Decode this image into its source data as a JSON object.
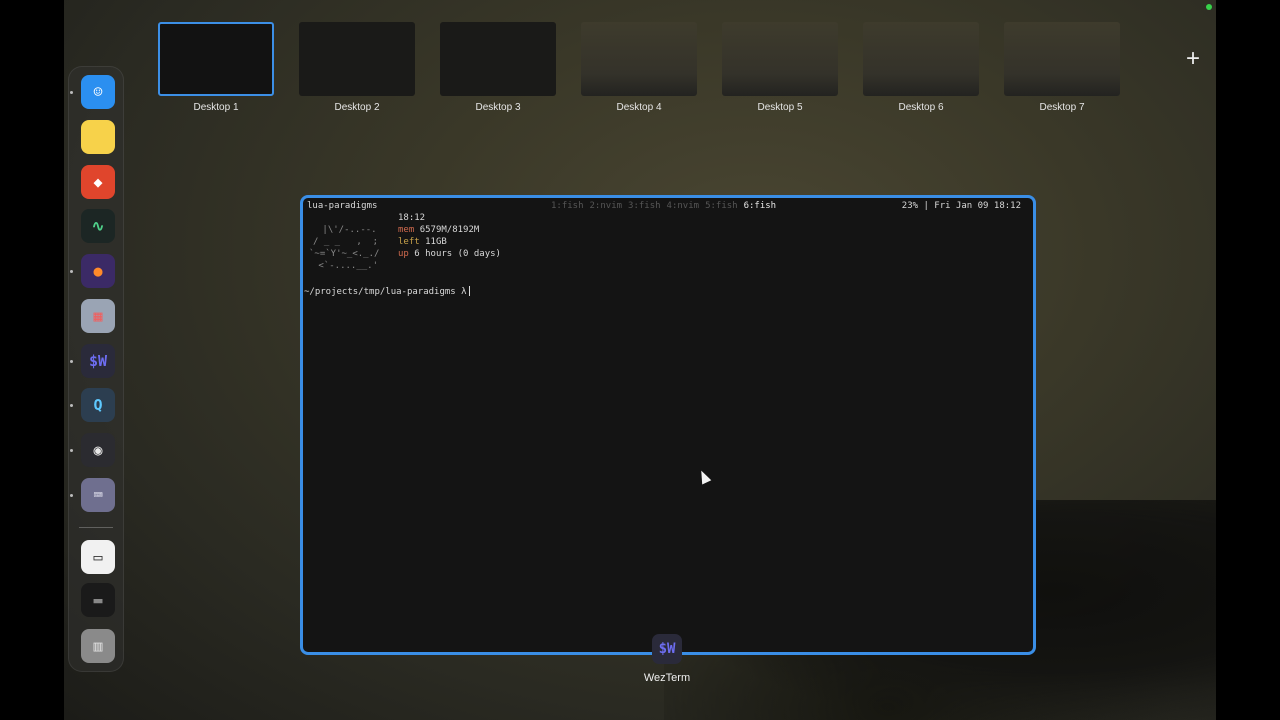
{
  "mission_control": {
    "spaces": [
      {
        "label": "Desktop 1",
        "active": true
      },
      {
        "label": "Desktop 2",
        "active": false
      },
      {
        "label": "Desktop 3",
        "active": false
      },
      {
        "label": "Desktop 4",
        "active": false
      },
      {
        "label": "Desktop 5",
        "active": false
      },
      {
        "label": "Desktop 6",
        "active": false
      },
      {
        "label": "Desktop 7",
        "active": false
      }
    ],
    "add_space_label": "+"
  },
  "dock": {
    "items": [
      {
        "name": "finder-icon",
        "glyph": "☺",
        "bg": "#2b8ff0",
        "fg": "#ffffff",
        "running": true
      },
      {
        "name": "notes-icon",
        "glyph": "",
        "bg": "#f7d24a",
        "fg": "#ffffff",
        "running": false
      },
      {
        "name": "fox-app-icon",
        "glyph": "◆",
        "bg": "#e0452c",
        "fg": "#ffffff",
        "running": false
      },
      {
        "name": "activity-monitor-icon",
        "glyph": "∿",
        "bg": "#1c2624",
        "fg": "#4fd08a",
        "running": false
      },
      {
        "name": "firefox-icon",
        "glyph": "●",
        "bg": "#3b2a66",
        "fg": "#ff8a2a",
        "running": true
      },
      {
        "name": "launchpad-icon",
        "glyph": "▦",
        "bg": "#9aa4b4",
        "fg": "#f06060",
        "running": false
      },
      {
        "name": "wezterm-icon",
        "glyph": "$W",
        "bg": "#2a2a3a",
        "fg": "#6d6df0",
        "running": true
      },
      {
        "name": "quicktime-icon",
        "glyph": "Q",
        "bg": "#2c3e50",
        "fg": "#5ec9ff",
        "running": true
      },
      {
        "name": "obs-icon",
        "glyph": "◉",
        "bg": "#2b2b30",
        "fg": "#e8e8e8",
        "running": true
      },
      {
        "name": "keyboard-app-icon",
        "glyph": "⌨",
        "bg": "#6f6f8f",
        "fg": "#e4e4f0",
        "running": true
      },
      {
        "name": "documents-folder-icon",
        "glyph": "▭",
        "bg": "#f1f1f1",
        "fg": "#333333",
        "running": false
      },
      {
        "name": "terminal-preview-icon",
        "glyph": "▬",
        "bg": "#1a1a1a",
        "fg": "#888888",
        "running": false
      },
      {
        "name": "trash-icon",
        "glyph": "▥",
        "bg": "#8a8a8a",
        "fg": "#dddddd",
        "running": false
      }
    ]
  },
  "terminal": {
    "session_name": "lua-paradigms",
    "tabs": [
      {
        "label": "1:fish",
        "current": false
      },
      {
        "label": "2:nvim",
        "current": false
      },
      {
        "label": "3:fish",
        "current": false
      },
      {
        "label": "4:nvim",
        "current": false
      },
      {
        "label": "5:fish",
        "current": false
      },
      {
        "label": "6:fish",
        "current": true
      }
    ],
    "status": "23% | Fri Jan 09 18:12",
    "ascii_art": [
      " |\\'/-..--.",
      "/ _ _   ,  ;",
      "`~=`Y'~_<._./",
      " <`-....__.'"
    ],
    "sysinfo": {
      "time": "18:12",
      "mem_key": "mem",
      "mem_val": "6579M/8192M",
      "left_key": "left",
      "left_val": "11GB",
      "up_key": "up",
      "up_val": "6 hours (0 days)"
    },
    "prompt": "~/projects/tmp/lua-paradigms λ"
  },
  "window_label": {
    "app_name": "WezTerm",
    "icon_glyph": "$W"
  }
}
